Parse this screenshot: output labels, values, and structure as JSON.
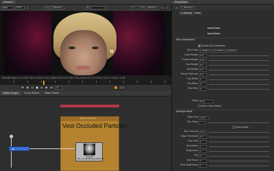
{
  "viewer": {
    "tab": "Viewer1",
    "toolbar": {
      "channel_layer": "rgba",
      "channel": "RGB",
      "input_a": "A",
      "input_a_source": "5_Beauty2",
      "input_b": "B",
      "input_b_source": "",
      "zoom": "1:1",
      "gain": "f/8",
      "proxy": "2D",
      "lut": "default"
    },
    "status_line": "500x360 bbox: 0 0 1320 720 x=150 y=120 | RGB 0.45 0.32 0.28 0.70 | frame 52 | H: 0.09 S: 0.41 V: 0.45 L: 0.28",
    "frame": "52"
  },
  "node_graph": {
    "tabs": [
      "Node Graph",
      "Curve Editor",
      "Dope Sheet"
    ],
    "backdrop_label": "BackdropNode1",
    "backdrop_title": "Vest Occluded Particles",
    "read_node": {
      "name": "Read20",
      "file": "vest_occludedParticles.####.exr"
    }
  },
  "properties": {
    "tab": "Properties",
    "node_name": "5_Beauty2",
    "subtabs": [
      "5_Beauty2",
      "Node"
    ],
    "buttons": {
      "load_preset": "Load Preset",
      "save_preset": "Save Preset"
    },
    "section_skin": "Skin Adjustment",
    "enable_label": "Enable Skin Detection",
    "rows": [
      {
        "label": "Skin Color",
        "values": [
          "0.358411",
          "0.276338",
          "0.259672"
        ]
      },
      {
        "label": "Luma Range",
        "values": [
          "0.4"
        ]
      },
      {
        "label": "Chroma Range",
        "values": [
          "0.16"
        ]
      },
      {
        "label": "Hue Range",
        "values": [
          "0.2"
        ]
      },
      {
        "label": "Sat Range",
        "values": [
          "0.3"
        ]
      },
      {
        "label": "Range Softness",
        "values": [
          "0.2"
        ]
      },
      {
        "label": "Clip White",
        "values": [
          "1"
        ]
      },
      {
        "label": "Clip Black",
        "values": [
          "0"
        ]
      },
      {
        "label": "Pixel Blur",
        "values": [
          "0"
        ]
      }
    ],
    "show_label": "Show",
    "show_value": "Final",
    "show_color_helper": "Show Color Helper",
    "section_bwise": "Sarilage Mask",
    "base_use_label": "Base Use",
    "base_use_value": "Luma",
    "blur_mask_label": "Blur Mask",
    "invert_mask_label": "Invert Mask",
    "rows2": [
      {
        "label": "Blur Amount",
        "values": [
          "0.15"
        ]
      },
      {
        "label": "Edge Threshold",
        "values": [
          "0.7"
        ]
      },
      {
        "label": "Hue Shift",
        "values": [
          "0"
        ]
      },
      {
        "label": "Saturation",
        "values": [
          "1"
        ]
      },
      {
        "label": "Brightness",
        "values": [
          "1"
        ]
      },
      {
        "label": "Tint",
        "values": [
          "0"
        ]
      },
      {
        "label": "Soft Focus",
        "values": [
          "0"
        ]
      },
      {
        "label": "Glow Brightness",
        "values": [
          "1"
        ]
      }
    ]
  },
  "colors": {
    "accent": "#e89a22",
    "backdrop": "#b5832f",
    "node_blue": "#3c6fd0",
    "red_bar": "#b8354a"
  }
}
